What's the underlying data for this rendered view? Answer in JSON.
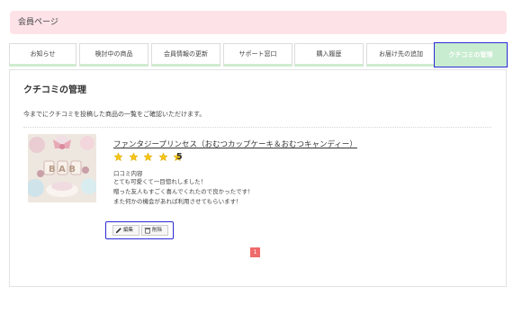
{
  "header": {
    "title": "会員ページ"
  },
  "tabs": [
    {
      "label": "お知らせ"
    },
    {
      "label": "検討中の商品"
    },
    {
      "label": "会員情報の更新"
    },
    {
      "label": "サポート窓口"
    },
    {
      "label": "購入履歴"
    },
    {
      "label": "お届け先の追加"
    },
    {
      "label": "クチコミの管理",
      "active": true
    }
  ],
  "panel": {
    "title": "クチコミの管理",
    "description": "今までにクチコミを投稿した商品の一覧をご確認いただけます。"
  },
  "review": {
    "product_name": "ファンタジープリンセス（おむつカップケーキ＆おむつキャンディー）",
    "rating": "5",
    "rating_value": 5,
    "rating_max": 5,
    "label": "口コミ内容",
    "lines": [
      "とても可愛くて一目惚れしました！",
      "贈った友人もすごく喜んでくれたので良かったです！",
      "また何かの機会があれば利用させてもらいます！"
    ],
    "thumb_text": "B A B",
    "edit_label": "編集",
    "delete_label": "削除"
  },
  "pagination": {
    "current": "1"
  },
  "colors": {
    "header_bg": "#fde3e7",
    "active_tab_bg": "#c8ecd0",
    "accent_border": "#2a2ad4",
    "page_badge": "#ef6a6a",
    "star": "#f5c518"
  },
  "icons": {
    "star": "star-icon",
    "edit": "pencil-icon",
    "delete": "trash-icon"
  }
}
